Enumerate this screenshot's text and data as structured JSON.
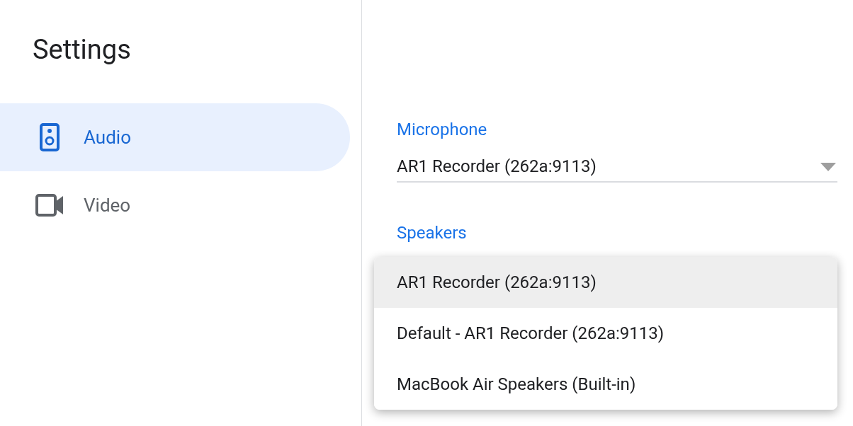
{
  "title": "Settings",
  "nav": [
    {
      "kind": "audio",
      "label": "Audio",
      "selected": true
    },
    {
      "kind": "video",
      "label": "Video",
      "selected": false
    }
  ],
  "microphone": {
    "label": "Microphone",
    "value": "AR1 Recorder (262a:9113)"
  },
  "speakers": {
    "label": "Speakers",
    "options": [
      {
        "label": "AR1 Recorder (262a:9113)",
        "selected": true
      },
      {
        "label": "Default - AR1 Recorder (262a:9113)",
        "selected": false
      },
      {
        "label": "MacBook Air Speakers (Built-in)",
        "selected": false
      }
    ]
  }
}
